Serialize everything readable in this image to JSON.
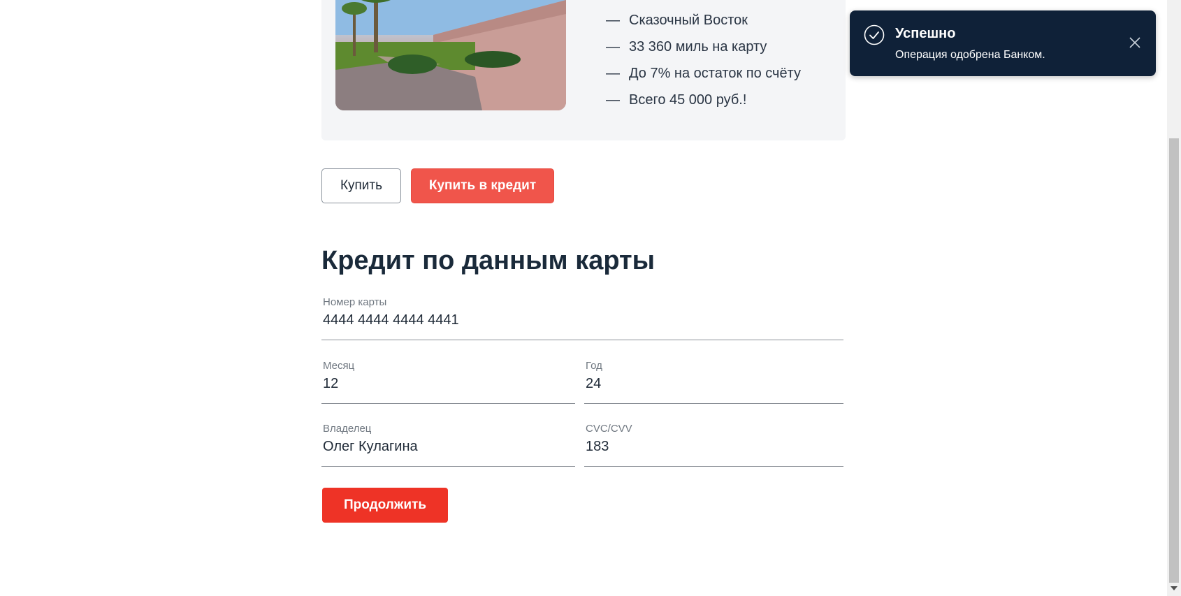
{
  "product": {
    "image_icon": "photo-marrakech-wall",
    "features": [
      "Сказочный Восток",
      "33 360 миль на карту",
      "До 7% на остаток по счёту",
      "Всего 45 000 руб.!"
    ],
    "dash": "—"
  },
  "actions": {
    "buy_label": "Купить",
    "buy_credit_label": "Купить в кредит"
  },
  "form": {
    "title": "Кредит по данным карты",
    "card_number": {
      "label": "Номер карты",
      "value": "4444 4444 4444 4441"
    },
    "month": {
      "label": "Месяц",
      "value": "12"
    },
    "year": {
      "label": "Год",
      "value": "24"
    },
    "owner": {
      "label": "Владелец",
      "value": "Олег Кулагина"
    },
    "cvc": {
      "label": "CVC/CVV",
      "value": "183"
    },
    "continue_label": "Продолжить"
  },
  "toast": {
    "title": "Успешно",
    "message": "Операция одобрена Банком.",
    "status_icon": "check-circle-icon",
    "close_icon": "close-icon"
  },
  "colors": {
    "accent_red": "#f0554b",
    "continue_red": "#ee3326",
    "toast_bg": "#0f2138",
    "card_bg": "#f4f5f7"
  }
}
